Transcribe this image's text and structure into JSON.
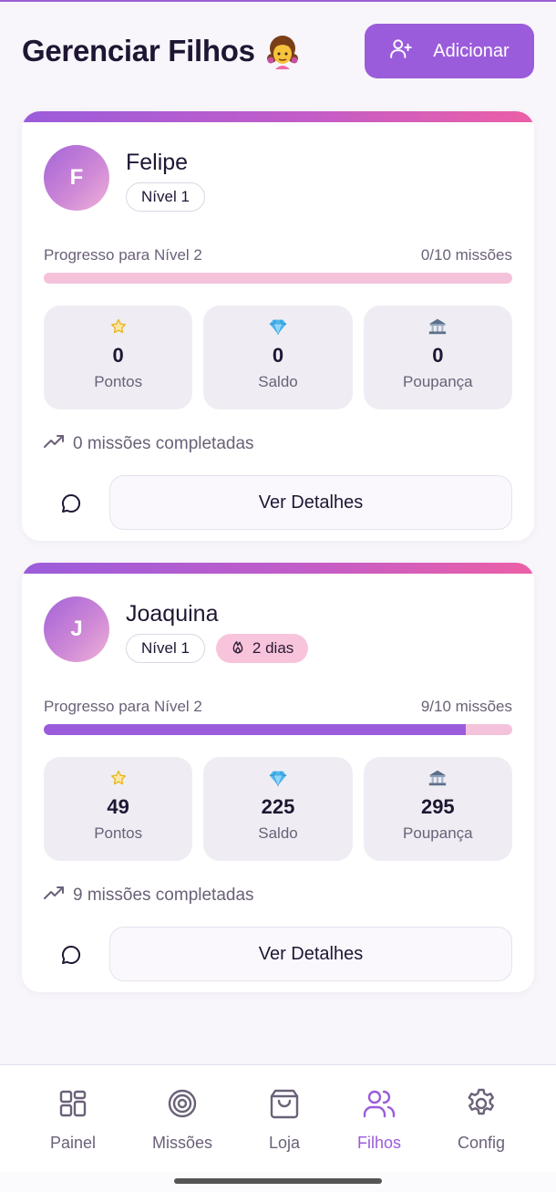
{
  "header": {
    "title": "Gerenciar Filhos",
    "title_emoji": "👧",
    "add_button_label": "Adicionar"
  },
  "children": [
    {
      "initial": "F",
      "name": "Felipe",
      "level_badge": "Nível 1",
      "streak_badge": null,
      "progress_label": "Progresso para Nível 2",
      "progress_count": "0/10 missões",
      "progress_fraction": 0.0,
      "stats": [
        {
          "icon": "star-icon",
          "value": "0",
          "label": "Pontos"
        },
        {
          "icon": "diamond-icon",
          "value": "0",
          "label": "Saldo"
        },
        {
          "icon": "bank-icon",
          "value": "0",
          "label": "Poupança"
        }
      ],
      "missions_completed": "0 missões completadas",
      "details_button_label": "Ver Detalhes"
    },
    {
      "initial": "J",
      "name": "Joaquina",
      "level_badge": "Nível 1",
      "streak_badge": "2 dias",
      "progress_label": "Progresso para Nível 2",
      "progress_count": "9/10 missões",
      "progress_fraction": 0.9,
      "stats": [
        {
          "icon": "star-icon",
          "value": "49",
          "label": "Pontos"
        },
        {
          "icon": "diamond-icon",
          "value": "225",
          "label": "Saldo"
        },
        {
          "icon": "bank-icon",
          "value": "295",
          "label": "Poupança"
        }
      ],
      "missions_completed": "9 missões completadas",
      "details_button_label": "Ver Detalhes"
    }
  ],
  "nav": {
    "items": [
      {
        "label": "Painel",
        "icon": "grid-icon",
        "active": false
      },
      {
        "label": "Missões",
        "icon": "target-icon",
        "active": false
      },
      {
        "label": "Loja",
        "icon": "shopping-bag-icon",
        "active": false
      },
      {
        "label": "Filhos",
        "icon": "users-icon",
        "active": true
      },
      {
        "label": "Config",
        "icon": "gear-icon",
        "active": false
      }
    ]
  },
  "colors": {
    "accent": "#9b5cdb",
    "pink": "#ec5fa6",
    "progress_track": "#f4c2da",
    "stat_bg": "#efedf3",
    "muted_text": "#6b6178"
  }
}
